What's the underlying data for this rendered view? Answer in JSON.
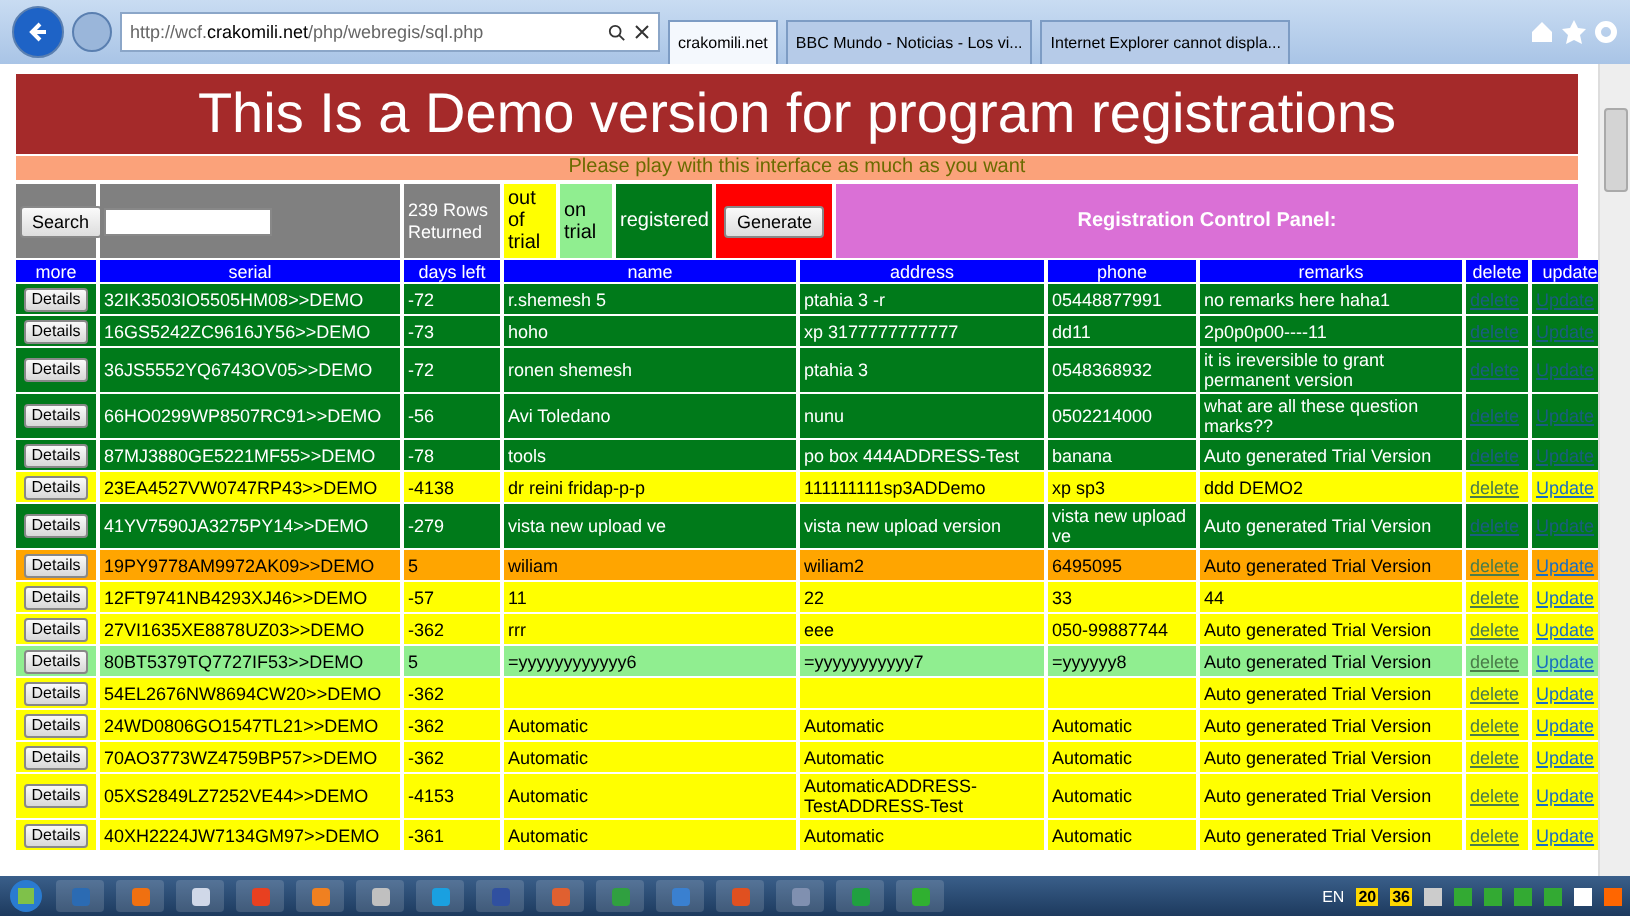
{
  "browser": {
    "url_prefix": "http://wcf.",
    "url_domain": "crakomili.net",
    "url_path": "/php/webregis/sql.php",
    "tabs": [
      {
        "label": "crakomili.net",
        "selected": true
      },
      {
        "label": "BBC Mundo - Noticias - Los vi...",
        "selected": false
      },
      {
        "label": "Internet Explorer cannot displa...",
        "selected": false
      }
    ]
  },
  "page": {
    "title": "This Is a Demo version for program registrations",
    "subtitle": "Please play with this interface as much as you want",
    "search_button": "Search",
    "rows_returned": "239 Rows Returned",
    "legend": [
      {
        "label": "out of trial",
        "color": "#ffff00"
      },
      {
        "label": "on trial",
        "color": "#90ee90"
      },
      {
        "label": "registered",
        "color": "#007a1a"
      }
    ],
    "generate_button": "Generate",
    "panel_title": "Registration Control Panel:",
    "columns": [
      "more",
      "serial",
      "days left",
      "name",
      "address",
      "phone",
      "remarks",
      "delete",
      "update"
    ],
    "rows": [
      {
        "details": "Details",
        "serial": "32IK3503IO5505HM08>>DEMO",
        "days": "-72",
        "name": "r.shemesh 5",
        "address": "ptahia 3 -r",
        "phone": "05448877991",
        "remarks": "no remarks here haha1",
        "delete": "delete",
        "update": "Update",
        "color": "#007a1a"
      },
      {
        "details": "Details",
        "serial": "16GS5242ZC9616JY56>>DEMO",
        "days": "-73",
        "name": "hoho",
        "address": "xp 3177777777777",
        "phone": "dd11",
        "remarks": "2p0p0p00----11",
        "delete": "delete",
        "update": "Update",
        "color": "#007a1a"
      },
      {
        "details": "Details",
        "serial": "36JS5552YQ6743OV05>>DEMO",
        "days": "-72",
        "name": "ronen shemesh",
        "address": "ptahia 3",
        "phone": "0548368932",
        "remarks": "it is ireversible to grant permanent version",
        "delete": "delete",
        "update": "Update",
        "color": "#007a1a"
      },
      {
        "details": "Details",
        "serial": "66HO0299WP8507RC91>>DEMO",
        "days": "-56",
        "name": "Avi Toledano",
        "address": "nunu",
        "phone": "0502214000",
        "remarks": "what are all these question marks??",
        "delete": "delete",
        "update": "Update",
        "color": "#007a1a"
      },
      {
        "details": "Details",
        "serial": "87MJ3880GE5221MF55>>DEMO",
        "days": "-78",
        "name": "tools",
        "address": "po box 444ADDRESS-Test",
        "phone": "banana",
        "remarks": "Auto generated Trial Version",
        "delete": "delete",
        "update": "Update",
        "color": "#007a1a"
      },
      {
        "details": "Details",
        "serial": "23EA4527VW0747RP43>>DEMO",
        "days": "-4138",
        "name": "dr reini fridap-p-p",
        "address": "111111111sp3ADDemo",
        "phone": "xp sp3",
        "remarks": "ddd DEMO2",
        "delete": "delete",
        "update": "Update",
        "color": "#ffff00"
      },
      {
        "details": "Details",
        "serial": "41YV7590JA3275PY14>>DEMO",
        "days": "-279",
        "name": "vista new upload ve",
        "address": "vista new upload version",
        "phone": "vista new upload ve",
        "remarks": "Auto generated Trial Version",
        "delete": "delete",
        "update": "Update",
        "color": "#007a1a"
      },
      {
        "details": "Details",
        "serial": "19PY9778AM9972AK09>>DEMO",
        "days": "5",
        "name": "wiliam",
        "address": "wiliam2",
        "phone": "6495095",
        "remarks": "Auto generated Trial Version",
        "delete": "delete",
        "update": "Update",
        "color": "#ffa500"
      },
      {
        "details": "Details",
        "serial": "12FT9741NB4293XJ46>>DEMO",
        "days": "-57",
        "name": "11",
        "address": "22",
        "phone": "33",
        "remarks": "44",
        "delete": "delete",
        "update": "Update",
        "color": "#ffff00"
      },
      {
        "details": "Details",
        "serial": "27VI1635XE8878UZ03>>DEMO",
        "days": "-362",
        "name": "rrr",
        "address": "eee",
        "phone": "050-99887744",
        "remarks": "Auto generated Trial Version",
        "delete": "delete",
        "update": "Update",
        "color": "#ffff00"
      },
      {
        "details": "Details",
        "serial": "80BT5379TQ7727IF53>>DEMO",
        "days": "5",
        "name": "=yyyyyyyyyyyy6",
        "address": "=yyyyyyyyyyy7",
        "phone": "=yyyyyy8",
        "remarks": "Auto generated Trial Version",
        "delete": "delete",
        "update": "Update",
        "color": "#90ee90"
      },
      {
        "details": "Details",
        "serial": "54EL2676NW8694CW20>>DEMO",
        "days": "-362",
        "remarks": "Auto generated Trial Version",
        "delete": "delete",
        "update": "Update",
        "color": "#ffff00"
      },
      {
        "details": "Details",
        "serial": "24WD0806GO1547TL21>>DEMO",
        "days": "-362",
        "name": "Automatic",
        "address": "Automatic",
        "phone": "Automatic",
        "remarks": "Auto generated Trial Version",
        "delete": "delete",
        "update": "Update",
        "color": "#ffff00"
      },
      {
        "details": "Details",
        "serial": "70AO3773WZ4759BP57>>DEMO",
        "days": "-362",
        "name": "Automatic",
        "address": "Automatic",
        "phone": "Automatic",
        "remarks": "Auto generated Trial Version",
        "delete": "delete",
        "update": "Update",
        "color": "#ffff00"
      },
      {
        "details": "Details",
        "serial": "05XS2849LZ7252VE44>>DEMO",
        "days": "-4153",
        "name": "Automatic",
        "address": "AutomaticADDRESS-TestADDRESS-Test",
        "phone": "Automatic",
        "remarks": "Auto generated Trial Version",
        "delete": "delete",
        "update": "Update",
        "color": "#ffff00"
      },
      {
        "details": "Details",
        "serial": "40XH2224JW7134GM97>>DEMO",
        "days": "-361",
        "name": "Automatic",
        "address": "Automatic",
        "phone": "Automatic",
        "remarks": "Auto generated Trial Version",
        "delete": "delete",
        "update": "Update",
        "color": "#ffff00"
      }
    ]
  },
  "taskbar": {
    "language": "EN",
    "tray_numbers": [
      "20",
      "36"
    ]
  }
}
